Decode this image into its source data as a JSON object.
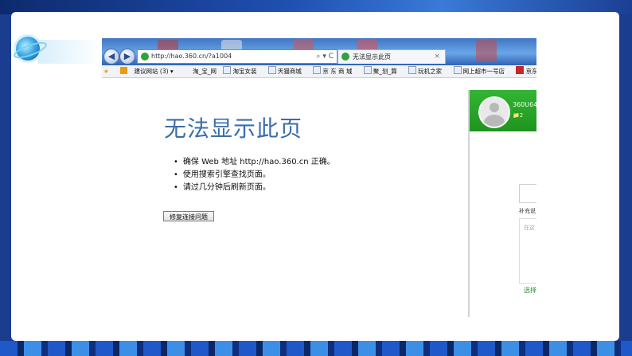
{
  "colors": {
    "frame": "#1a3d8f",
    "title_blue": "#3b6ea8",
    "sidebar_green": "#2aa62a"
  },
  "browser": {
    "address_url": "http://hao.360.cn/?a1004",
    "address_tools": "⌕ ▾ C",
    "tab_title": "无法显示此页",
    "tab_close": "×",
    "favorites": {
      "suggested": "建议网站 (3) ▾",
      "items": [
        "淘_宝_网",
        "淘宝女装",
        "天猫商城",
        "京 东 商 城",
        "聚_划_算",
        "玩机之家",
        "网上超市一号店",
        "京东网上商城"
      ]
    }
  },
  "error_page": {
    "title": "无法显示此页",
    "tips": [
      "确保 Web 地址 http://hao.360.cn 正确。",
      "使用搜索引擎查找页面。",
      "请过几分钟后刷新页面。"
    ],
    "fix_button": "修复连接问题"
  },
  "sidebar": {
    "username": "360U64",
    "count": "📁2",
    "input_label": "补充说",
    "textarea_placeholder": "在这",
    "link": "选择"
  },
  "icons": [
    "back-arrow-icon",
    "forward-arrow-icon",
    "favorites-star-icon",
    "site-favicon",
    "globe-icon",
    "avatar-icon"
  ]
}
